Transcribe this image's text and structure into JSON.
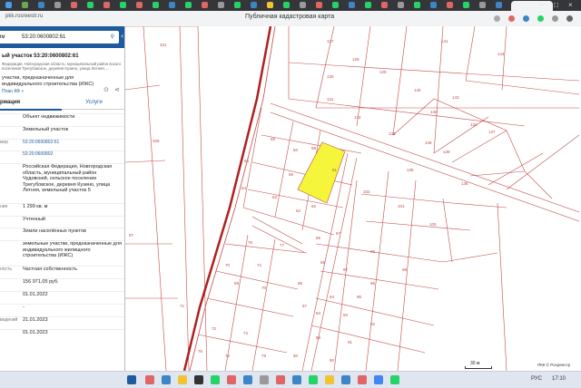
{
  "browser": {
    "url": "pkk.rosreestr.ru",
    "page_title": "Публичная кадастровая карта"
  },
  "panel": {
    "search_label": "им",
    "search_value": "53:20:0600802:61",
    "title": "ый участок 53:20:0600802:61",
    "address": "Федерация, Новгородская область, муниципальный район вского поселения Трегубовское, деревня Кузино, улица Летняя, ...",
    "use_type": "участки, предназначенные для индивидуального строительства (ИЖС)",
    "plan_link": "План КФ »",
    "tab_info": "рмация",
    "tab_services": "Услуги",
    "rows": [
      {
        "key": "",
        "value": "Объект недвижимости"
      },
      {
        "key": "",
        "value": "Земельный участок"
      },
      {
        "key": "мер",
        "value": "53:20:0600802:61"
      },
      {
        "key": "",
        "value": "53:20:0600802"
      },
      {
        "key": "",
        "value": "Российская Федерация, Новгородская область, муниципальный район Чудовский, сельское поселение Трегубовское, деревня Кузино, улица Летняя, земельный участок 5"
      },
      {
        "key": "ния",
        "value": "1 299 кв. м"
      },
      {
        "key": "",
        "value": "Учтенный"
      },
      {
        "key": "",
        "value": "Земли населённых пунктов"
      },
      {
        "key": "",
        "value": "земельные участки, предназначенные для индивидуального жилищного строительства (ИЖС)"
      },
      {
        "key": "ность",
        "value": "Частная собственность"
      },
      {
        "key": "",
        "value": "156 971,05 руб."
      },
      {
        "key": "",
        "value": "01.01.2022"
      },
      {
        "key": "",
        "value": "-"
      },
      {
        "key": "ведений",
        "value": "21.01.2023"
      },
      {
        "key": "",
        "value": "01.01.2023"
      }
    ]
  },
  "map": {
    "parcel_labels": [
      "331",
      "127",
      "141",
      "144",
      "328",
      "130",
      "129",
      "140",
      "143",
      "131",
      "132",
      "136",
      "134",
      "137",
      "59",
      "60",
      "61",
      "63",
      "64",
      "65",
      "128",
      "133",
      "135",
      "138",
      "139",
      "142",
      "58",
      "62",
      "66",
      "70",
      "71",
      "72",
      "73",
      "74",
      "75",
      "76",
      "77",
      "78",
      "79",
      "80",
      "81",
      "82",
      "83",
      "84",
      "85",
      "86",
      "87",
      "88",
      "89",
      "90",
      "91",
      "92",
      "93",
      "94",
      "95",
      "96",
      "97",
      "98",
      "99",
      "100",
      "101",
      "102",
      "103",
      "126"
    ],
    "highlight_color": "#f5f53c",
    "scale_label": "30 м",
    "copyright": "ПКК © Росреестр"
  },
  "taskbar": {
    "lang": "РУС",
    "time": "17:10"
  }
}
